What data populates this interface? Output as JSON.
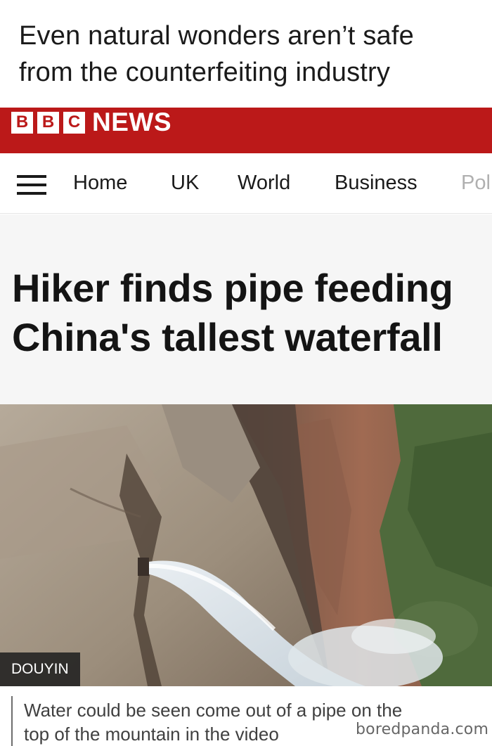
{
  "meme_caption": {
    "line1": "Even natural wonders aren’t safe",
    "line2": "from the counterfeiting industry"
  },
  "header": {
    "logo_letters": [
      "B",
      "B",
      "C"
    ],
    "brand": "NEWS",
    "brand_color": "#bb1919"
  },
  "nav": {
    "menu_icon": "hamburger-menu-icon",
    "items": [
      "Home",
      "UK",
      "World",
      "Business",
      "Pol"
    ]
  },
  "article": {
    "headline_line1": "Hiker finds pipe feeding",
    "headline_line2": "China's tallest waterfall",
    "image_credit": "DOUYIN",
    "image_caption_line1": "Water could be seen come out of a pipe on the",
    "image_caption_line2": "top of the mountain in the video"
  },
  "watermark": "boredpanda.com"
}
